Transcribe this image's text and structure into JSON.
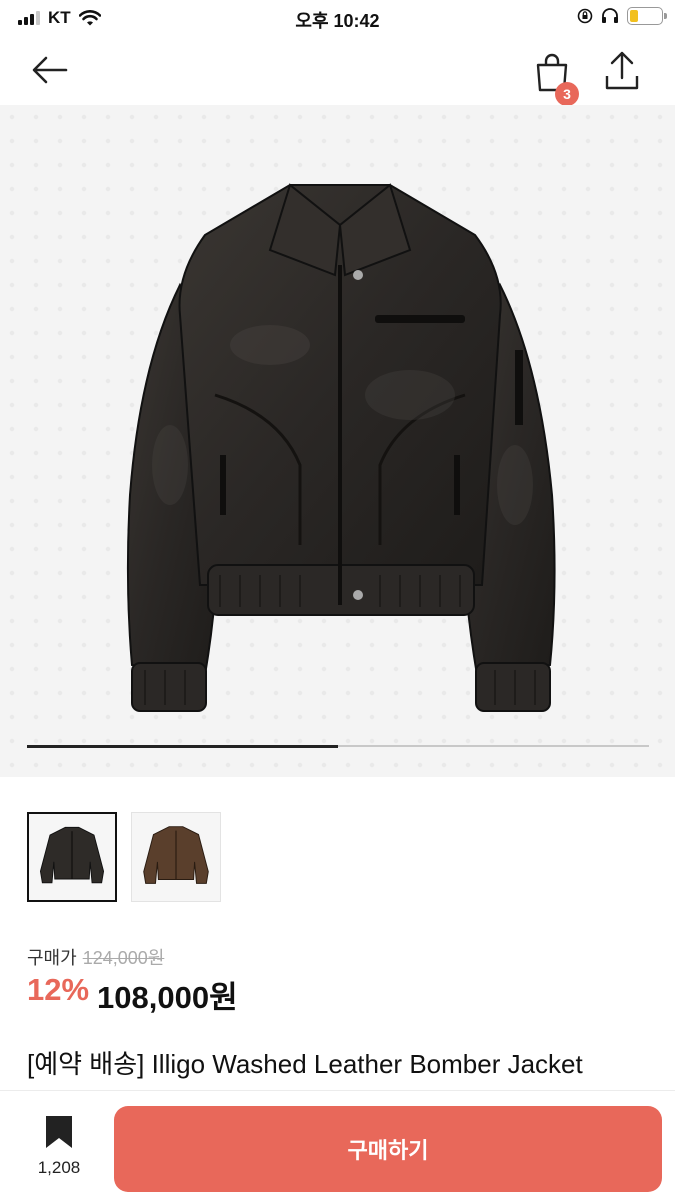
{
  "status_bar": {
    "carrier": "KT",
    "time": "오후 10:42",
    "battery_color": "#f2c01e"
  },
  "nav": {
    "back_icon": "arrow-left-icon",
    "cart_icon": "shopping-bag-icon",
    "cart_count": "3",
    "share_icon": "share-icon"
  },
  "gallery": {
    "progress": 0.5,
    "thumbnails": [
      {
        "color": "black",
        "active": true
      },
      {
        "color": "brown",
        "active": false
      }
    ]
  },
  "product": {
    "price_label": "구매가",
    "original_price": "124,000원",
    "discount": "12%",
    "sale_price": "108,000원",
    "title": "[예약 배송] Illigo Washed Leather Bomber Jacket Black"
  },
  "bottom_bar": {
    "bookmark_icon": "bookmark-icon",
    "bookmark_count": "1,208",
    "buy_label": "구매하기"
  },
  "colors": {
    "accent": "#e8685a"
  }
}
